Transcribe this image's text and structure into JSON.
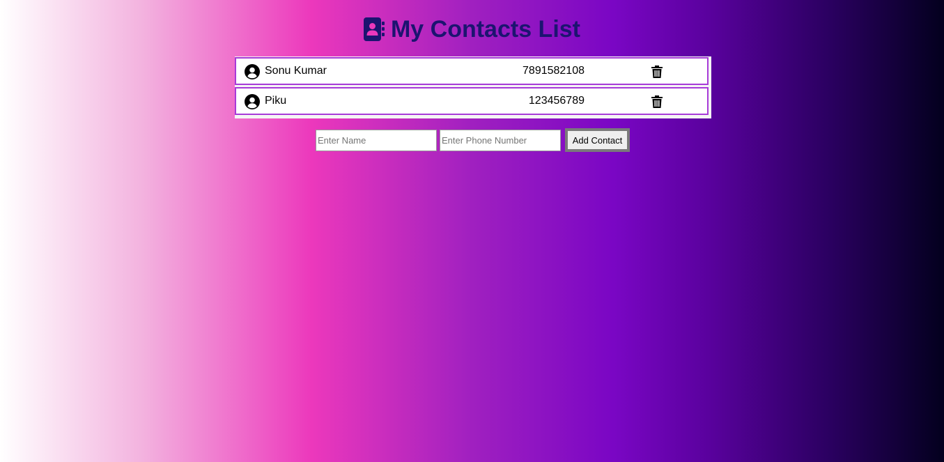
{
  "header": {
    "title": "My Contacts List",
    "icon": "address-book-icon",
    "title_color": "#1c1470"
  },
  "contacts": [
    {
      "name": "Sonu Kumar",
      "phone": "7891582108",
      "avatar_icon": "user-circle-icon",
      "delete_icon": "trash-icon"
    },
    {
      "name": "Piku",
      "phone": "123456789",
      "avatar_icon": "user-circle-icon",
      "delete_icon": "trash-icon"
    }
  ],
  "form": {
    "name_value": "",
    "name_placeholder": "Enter Name",
    "phone_value": "",
    "phone_placeholder": "Enter Phone Number",
    "add_label": "Add Contact"
  },
  "colors": {
    "row_border": "#a73ad8",
    "gradient": [
      "#ffffff",
      "#ec38bc",
      "#7a06c4",
      "#03001e"
    ]
  }
}
